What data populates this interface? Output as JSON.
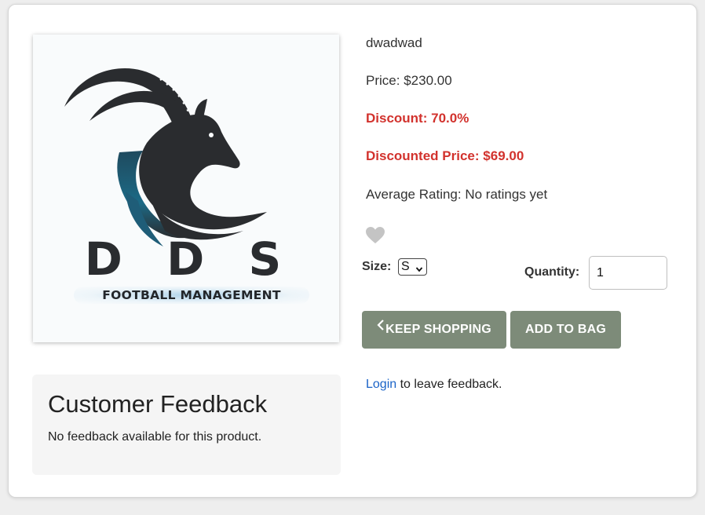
{
  "product": {
    "name": "dwadwad",
    "price_label": "Price:",
    "price_value": "$230.00",
    "discount_label": "Discount:",
    "discount_value": "70.0%",
    "discounted_label": "Discounted Price:",
    "discounted_value": "$69.00",
    "rating_label": "Average Rating:",
    "rating_value": "No ratings yet",
    "image": {
      "logo_letters": "D D S",
      "logo_subtitle": "FOOTBALL MANAGEMENT",
      "icon": "ibex-head-logo"
    }
  },
  "wishlist": {
    "icon": "heart-icon",
    "color": "#c4c4c4"
  },
  "options": {
    "size_label": "Size:",
    "size_selected": "S",
    "quantity_label": "Quantity:",
    "quantity_value": "1"
  },
  "buttons": {
    "keep_shopping": "KEEP SHOPPING",
    "add_to_bag": "ADD TO BAG",
    "color": "#7d8b79"
  },
  "feedback": {
    "title": "Customer Feedback",
    "empty_text": "No feedback available for this product.",
    "login_link": "Login",
    "login_suffix": " to leave feedback."
  },
  "colors": {
    "accent_red": "#d2322d",
    "link_blue": "#1a63c7"
  }
}
